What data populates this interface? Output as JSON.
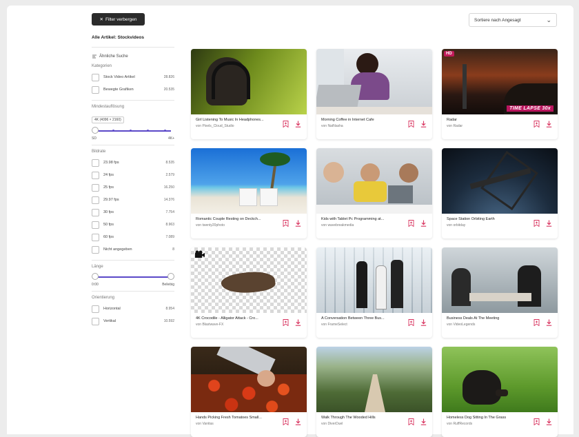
{
  "toolbar": {
    "filter_button": "Filter verbergen",
    "sort_selected": "Sortiere nach Angesagt"
  },
  "sidebar": {
    "heading": "Alle Artikel: Stockvideos",
    "similar_search": "Ähnliche Suche",
    "categories": {
      "title": "Kategorien",
      "items": [
        {
          "label": "Stock Video Artikel",
          "count": "28.826"
        },
        {
          "label": "Bewegte Grafiken",
          "count": "20.535"
        }
      ]
    },
    "min_resolution": {
      "title": "Mindestauflösung",
      "tooltip": "4K (4096 × 2160)",
      "min_label": "SD",
      "max_label": "4K+"
    },
    "fps": {
      "title": "Bildrate",
      "items": [
        {
          "label": "23.98 fps",
          "count": "8.535"
        },
        {
          "label": "24 fps",
          "count": "2.579"
        },
        {
          "label": "25 fps",
          "count": "16.250"
        },
        {
          "label": "29.97 fps",
          "count": "14.376"
        },
        {
          "label": "30 fps",
          "count": "7.754"
        },
        {
          "label": "50 fps",
          "count": "8.963"
        },
        {
          "label": "60 fps",
          "count": "7.089"
        },
        {
          "label": "Nicht angegeben",
          "count": "8"
        }
      ]
    },
    "length": {
      "title": "Länge",
      "min_label": "0:00",
      "max_label": "Beliebig"
    },
    "orientation": {
      "title": "Orientierung",
      "items": [
        {
          "label": "Horizontal",
          "count": "8.954"
        },
        {
          "label": "Vertikal",
          "count": "10.592"
        }
      ]
    }
  },
  "cards": [
    {
      "title": "Girl Listening To Music In Headphones...",
      "author": "von Pixels_Cloud_Studio",
      "badge_hd": "",
      "badge_tl": ""
    },
    {
      "title": "Morning Coffee in Internet Cafe",
      "author": "von NatNasha",
      "badge_hd": "",
      "badge_tl": ""
    },
    {
      "title": "Radar",
      "author": "von Radar",
      "badge_hd": "HD",
      "badge_tl": "TIME LAPSE 30x"
    },
    {
      "title": "Romantic Couple Resting on Deckch...",
      "author": "von twenty20photo",
      "badge_hd": "",
      "badge_tl": ""
    },
    {
      "title": "Kids with Tablet Pc Programming at...",
      "author": "von wavebreakmedia",
      "badge_hd": "",
      "badge_tl": ""
    },
    {
      "title": "Space Station Orbiting Earth",
      "author": "von orbitday",
      "badge_hd": "",
      "badge_tl": ""
    },
    {
      "title": "4K Crocodile - Alligator Attack - Cro...",
      "author": "von Blastwave-FX",
      "badge_hd": "",
      "badge_tl": ""
    },
    {
      "title": "A Conversation Between Three Bus...",
      "author": "von FrameSelect",
      "badge_hd": "",
      "badge_tl": ""
    },
    {
      "title": "Business Deals At The Meeting",
      "author": "von VideoLegends",
      "badge_hd": "",
      "badge_tl": ""
    },
    {
      "title": "Hands Picking Fresh Tomatoes Small...",
      "author": "von Vanitas",
      "badge_hd": "",
      "badge_tl": ""
    },
    {
      "title": "Walk Through The Wooded Hills",
      "author": "von DiverDuel",
      "badge_hd": "",
      "badge_tl": ""
    },
    {
      "title": "Homeless Dog Sitting In The Grass",
      "author": "von RuffRecords",
      "badge_hd": "",
      "badge_tl": ""
    }
  ],
  "colors": {
    "accent": "#5a48c8",
    "action_pink": "#d8325e",
    "dark_button": "#2b2b2b"
  },
  "icons": {
    "collection": "bookmark-plus-icon",
    "download": "download-icon"
  }
}
